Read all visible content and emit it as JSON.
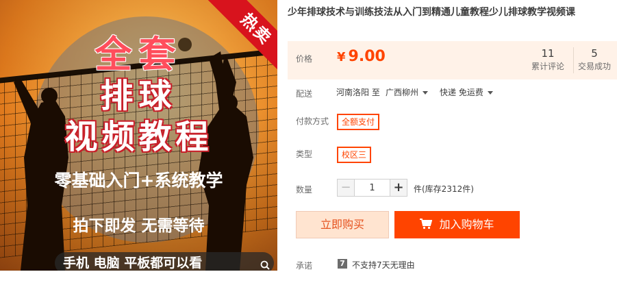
{
  "image": {
    "badge": "热卖",
    "title_lines": [
      "全套",
      "排球",
      "视频教程"
    ],
    "subtitle": "零基础入门+系统教学",
    "slogan": "拍下即发 无需等待",
    "device_banner": "手机 电脑 平板都可以看"
  },
  "product": {
    "title": "少年排球技术与训练技法从入门到精通儿童教程少儿排球教学视频课"
  },
  "price": {
    "label": "价格",
    "currency": "¥",
    "value": "9.00",
    "reviews_count": "11",
    "reviews_label": "累计评论",
    "sales_count": "5",
    "sales_label": "交易成功"
  },
  "shipping": {
    "label": "配送",
    "from": "河南洛阳 至",
    "to": "广西柳州",
    "method": "快递 免运费"
  },
  "payment": {
    "label": "付款方式",
    "selected": "全额支付"
  },
  "type": {
    "label": "类型",
    "selected": "校区三"
  },
  "quantity": {
    "label": "数量",
    "minus": "−",
    "value": "1",
    "plus": "+",
    "stock": "件(库存2312件)"
  },
  "actions": {
    "buy_now": "立即购买",
    "add_to_cart": "加入购物车"
  },
  "promise": {
    "label": "承诺",
    "icon_text": "7",
    "text": "不支持7天无理由"
  },
  "colors": {
    "accent": "#ff4400",
    "price": "#ff4400",
    "price_bg": "#fff2e8",
    "badge": "#d8131d"
  }
}
